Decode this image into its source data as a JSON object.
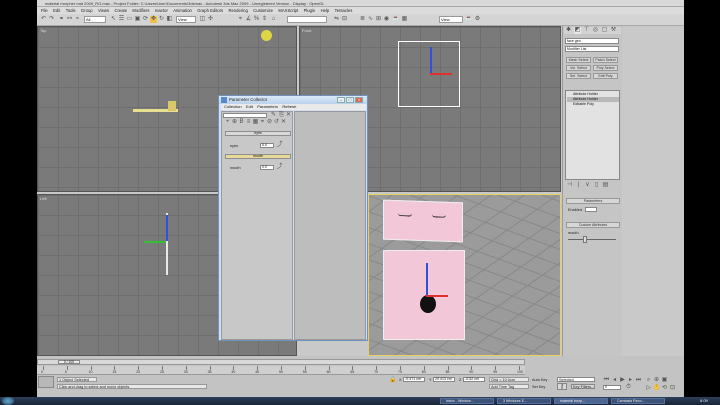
{
  "window": {
    "title": "material morpher mat 2009_RG.max - Project Folder: C:\\Users\\User\\Documents\\3dsmax - Autodesk 3ds Max 2009 - Unregistered Version - Display : OpenGL"
  },
  "menu": [
    "File",
    "Edit",
    "Tools",
    "Group",
    "Views",
    "Create",
    "Modifiers",
    "reactor",
    "Animation",
    "Graph Editors",
    "Rendering",
    "Customize",
    "MAXScript",
    "Plugin",
    "Help",
    "Tentacles"
  ],
  "toolbar": {
    "selection_filter": "All",
    "ref_coord": "View",
    "named_set": "View"
  },
  "viewports": {
    "top": "Top",
    "front": "Front",
    "left": "Left",
    "perspective": "Perspective"
  },
  "command_panel": {
    "object_name": "face geo",
    "modifier_list": "Modifier List",
    "buttons": [
      "Mesh Select",
      "Patch Select",
      "Vol. Select",
      "Poly Select",
      "Sel. Select",
      "Edit Poly"
    ],
    "stack": [
      "Attribute Holder",
      "Editable Poly"
    ],
    "stack_selected": "Attribute Holder",
    "rollout_parameters": "Parameters",
    "custom_attributes": "Custom Attributes",
    "slider_label": "mouth",
    "enabled_label": "Enabled"
  },
  "dialog": {
    "title": "Parameter Collector",
    "menu": [
      "Collection",
      "Edit",
      "Parameters",
      "Refresh"
    ],
    "rollout1": "eyes",
    "param1": {
      "label": "eyes",
      "value": "0.0"
    },
    "rollout2": "mouth",
    "param2": {
      "label": "mouth",
      "value": "0.0"
    }
  },
  "timeline": {
    "frame": "0 / 100",
    "ticks": [
      "0",
      "5",
      "10",
      "15",
      "20",
      "25",
      "30",
      "35",
      "40",
      "45",
      "50",
      "55",
      "60",
      "65",
      "70",
      "75",
      "80",
      "85",
      "90",
      "95",
      "100"
    ]
  },
  "status": {
    "selected": "1 Object Selected",
    "prompt": "Click and drag to select and move objects",
    "x": "-0.471 cm",
    "y": "20.413 cm",
    "z": "-0.52 cm",
    "grid": "Grid = 10.0cm",
    "auto_key": "Auto Key",
    "set_key": "Set Key",
    "selected_dropdown": "Selected",
    "key_filters": "Key Filters...",
    "add_time_tag": "Add Time Tag",
    "frame": "0",
    "max_to_physx": "Max to Physx"
  },
  "taskbar": {
    "items": [
      "Inbox - Window...",
      "3 Windows E...",
      "material morp...",
      "Camtasia Reco..."
    ],
    "clock": "8:09"
  }
}
